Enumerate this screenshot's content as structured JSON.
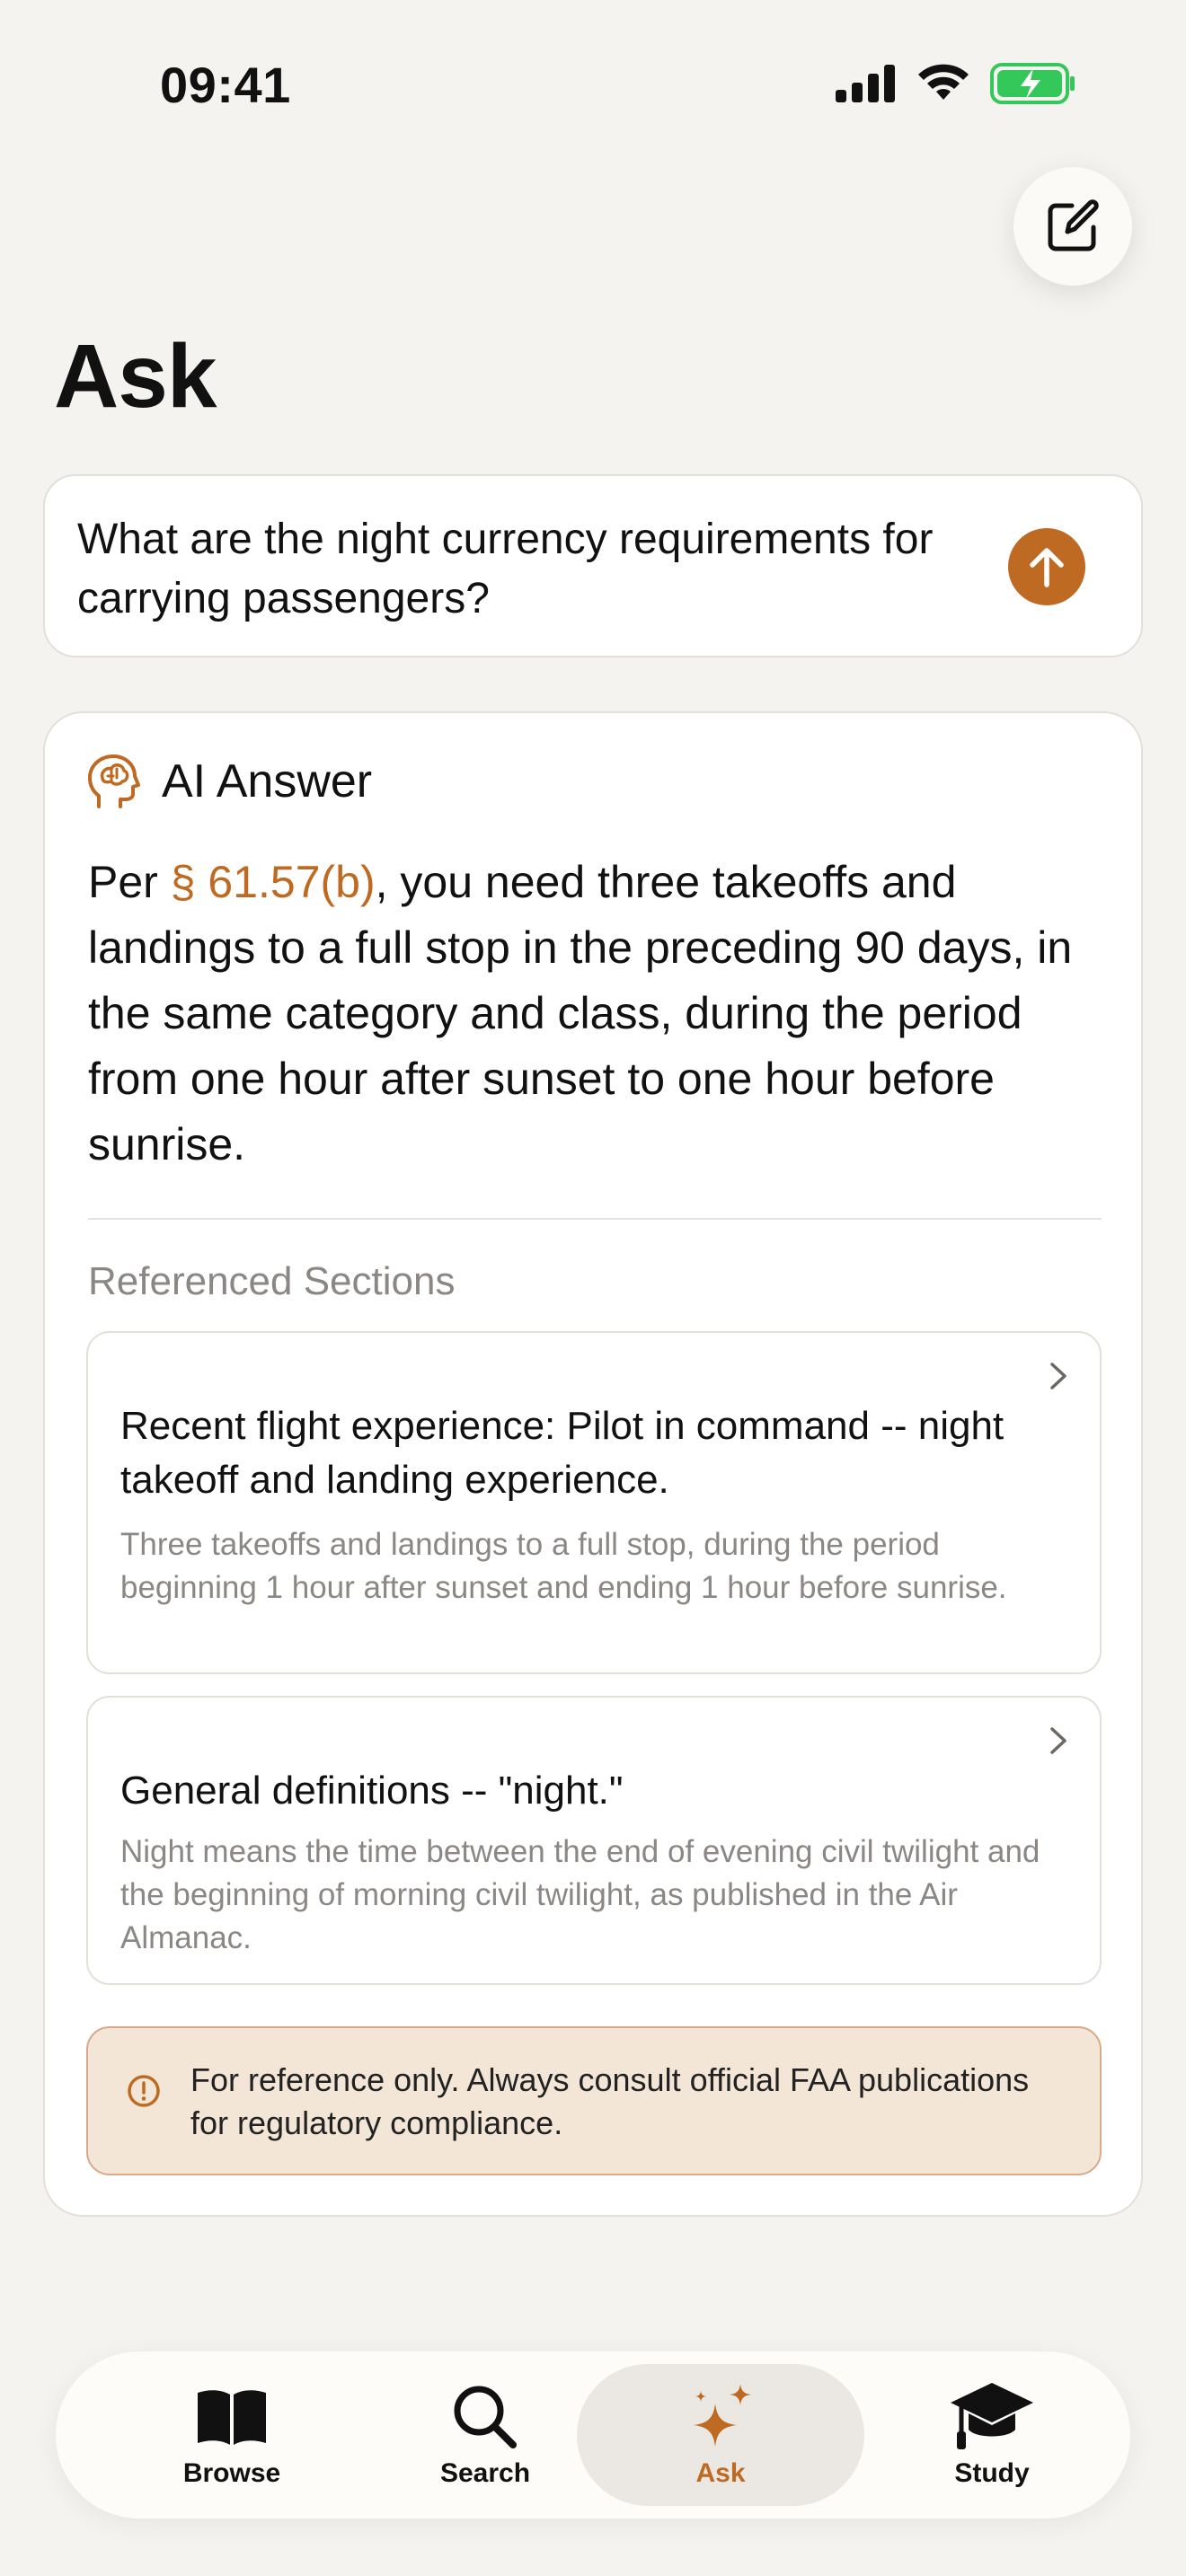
{
  "status_bar": {
    "time": "09:41"
  },
  "page": {
    "title": "Ask"
  },
  "question": {
    "text": "What are the night currency requirements for carrying passengers?"
  },
  "answer": {
    "title": "AI Answer",
    "body_prefix": "Per ",
    "citation": "§ 61.57(b)",
    "body_suffix": ", you need three takeoffs and landings to a full stop in the preceding 90 days, in the same category and class, during the period from one hour after sunset to one hour before sunrise.",
    "referenced_heading": "Referenced Sections",
    "references": [
      {
        "title": "Recent flight experience: Pilot in command -- night takeoff and landing experience.",
        "description": "Three takeoffs and landings to a full stop, during the period beginning 1 hour after sunset and ending 1 hour before sunrise."
      },
      {
        "title": "General definitions -- \"night.\"",
        "description": "Night means the time between the end of evening civil twilight and the beginning of morning civil twilight, as published in the Air Almanac."
      }
    ],
    "disclaimer": "For reference only. Always consult official FAA publications for regulatory compliance."
  },
  "tab_bar": {
    "items": [
      {
        "label": "Browse",
        "icon": "book-icon"
      },
      {
        "label": "Search",
        "icon": "search-icon"
      },
      {
        "label": "Ask",
        "icon": "sparkle-icon",
        "active": true
      },
      {
        "label": "Study",
        "icon": "graduation-cap-icon"
      }
    ]
  },
  "colors": {
    "accent": "#bf6a22",
    "background": "#f5f3ef",
    "disclaimer_bg": "#f3e6d7",
    "battery_green": "#34c759"
  }
}
